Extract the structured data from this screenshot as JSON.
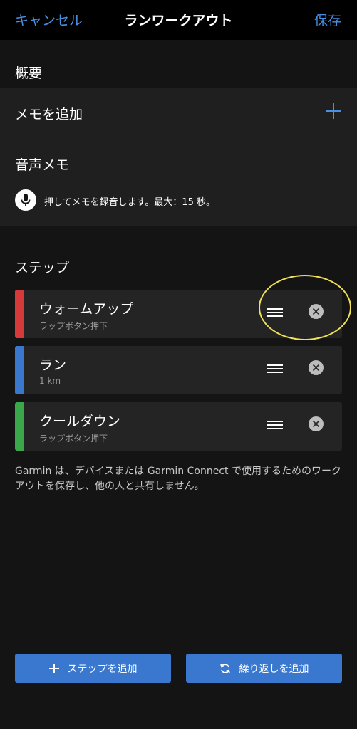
{
  "header": {
    "cancel_label": "キャンセル",
    "title": "ランワークアウト",
    "save_label": "保存"
  },
  "overview": {
    "section_label": "概要",
    "add_memo_label": "メモを追加",
    "add_icon": "plus-icon",
    "voice_memo_label": "音声メモ",
    "mic_icon": "microphone-icon",
    "record_hint": "押してメモを録音します。最大：15 秒。"
  },
  "steps": {
    "section_label": "ステップ",
    "items": [
      {
        "title": "ウォームアップ",
        "subtitle": "ラップボタン押下",
        "color": "#d43a3a"
      },
      {
        "title": "ラン",
        "subtitle": "1 km",
        "color": "#3a78d0"
      },
      {
        "title": "クールダウン",
        "subtitle": "ラップボタン押下",
        "color": "#3aa84a"
      }
    ]
  },
  "footer_note": "Garmin は、デバイスまたは Garmin Connect で使用するためのワークアウトを保存し、他の人と共有しません。",
  "actions": {
    "add_step_label": "ステップを追加",
    "add_repeat_label": "繰り返しを追加"
  },
  "colors": {
    "accent": "#4a90e2",
    "button": "#3a78d0",
    "highlight": "#f2e35a"
  }
}
